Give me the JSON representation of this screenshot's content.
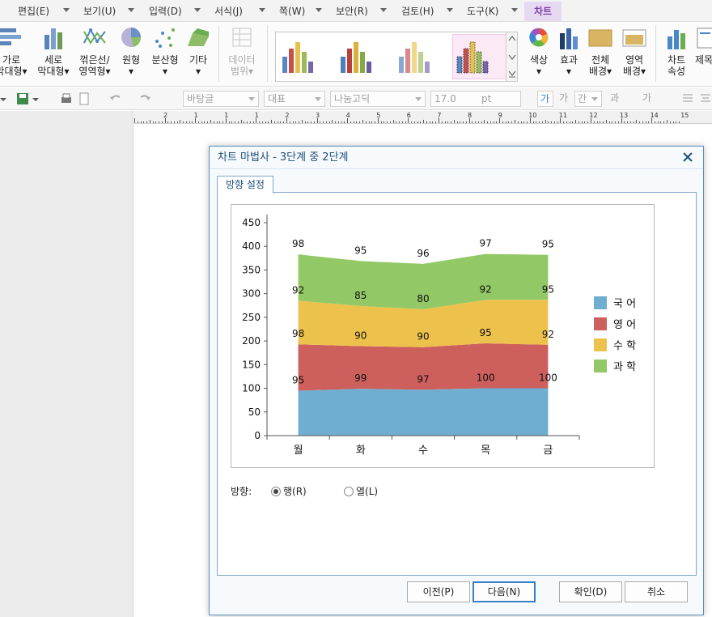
{
  "menu": {
    "items": [
      "편집(E)",
      "보기(U)",
      "입력(D)",
      "서식(J)",
      "쪽(W)",
      "보안(R)",
      "검토(H)",
      "도구(K)"
    ],
    "active": "차트"
  },
  "ribbon": {
    "buttons": [
      {
        "line1": "가로",
        "line2": "막대형▾",
        "icon": "horizontal-bar-icon"
      },
      {
        "line1": "세로",
        "line2": "막대형▾",
        "icon": "vertical-bar-icon"
      },
      {
        "line1": "꺾은선/",
        "line2": "영역형▾",
        "icon": "line-chart-icon"
      },
      {
        "line1": "원형",
        "line2": "▾",
        "icon": "pie-chart-icon"
      },
      {
        "line1": "분산형",
        "line2": "▾",
        "icon": "scatter-chart-icon"
      },
      {
        "line1": "기타",
        "line2": "▾",
        "icon": "other-chart-icon"
      },
      {
        "line1": "데이터",
        "line2": "범위▾",
        "icon": "data-range-icon"
      },
      {
        "line1": "색상",
        "line2": "▾",
        "icon": "color-icon"
      },
      {
        "line1": "효과",
        "line2": "▾",
        "icon": "effect-icon"
      },
      {
        "line1": "전체",
        "line2": "배경▾",
        "icon": "background-icon"
      },
      {
        "line1": "영역",
        "line2": "배경▾",
        "icon": "area-background-icon"
      },
      {
        "line1": "차트",
        "line2": "속성",
        "icon": "chart-properties-icon"
      },
      {
        "line1": "제목",
        "line2": "",
        "icon": "title-icon"
      }
    ]
  },
  "toolbar": {
    "style": "바탕글",
    "representative": "대표",
    "font": "나눔고딕",
    "size": "17.0",
    "size_unit": "pt",
    "bold_label": "가",
    "italic_label": "가",
    "underline_label": "간",
    "strike_label": "과",
    "super_label": "가"
  },
  "ruler": {
    "numbers": [
      "2",
      "1",
      "1",
      "1",
      "2",
      "3",
      "4",
      "5",
      "6",
      "7",
      "8",
      "9",
      "10",
      "11",
      "12",
      "13",
      "14",
      "15"
    ]
  },
  "dialog": {
    "title": "차트 마법사 - 3단계 중 2단계",
    "tab": "방향 설정",
    "direction_label": "방향:",
    "radio_row": "행(R)",
    "radio_col": "열(L)",
    "selected": "row",
    "buttons": {
      "prev": "이전(P)",
      "next": "다음(N)",
      "ok": "확인(D)",
      "cancel": "취소"
    }
  },
  "colors": {
    "korean": "#6faed1",
    "english": "#cd5f5c",
    "math": "#edc24c",
    "science": "#92c966",
    "menu_active_bg": "#e8d9f3",
    "dialog_border": "#5b8fc0"
  },
  "chart_data": {
    "type": "area",
    "stacked": true,
    "categories": [
      "월",
      "화",
      "수",
      "목",
      "금"
    ],
    "series": [
      {
        "name": "국 어",
        "values": [
          95,
          99,
          97,
          100,
          100
        ],
        "color": "#6faed1"
      },
      {
        "name": "영 어",
        "values": [
          98,
          90,
          90,
          95,
          92
        ],
        "color": "#cd5f5c"
      },
      {
        "name": "수 학",
        "values": [
          92,
          85,
          80,
          92,
          95
        ],
        "color": "#edc24c"
      },
      {
        "name": "과 학",
        "values": [
          98,
          95,
          96,
          97,
          95
        ],
        "color": "#92c966"
      }
    ],
    "yticks": [
      "0",
      "50",
      "100",
      "150",
      "200",
      "250",
      "300",
      "350",
      "400",
      "450"
    ],
    "ylim": [
      0,
      450
    ],
    "grid": false,
    "legend": "right"
  }
}
